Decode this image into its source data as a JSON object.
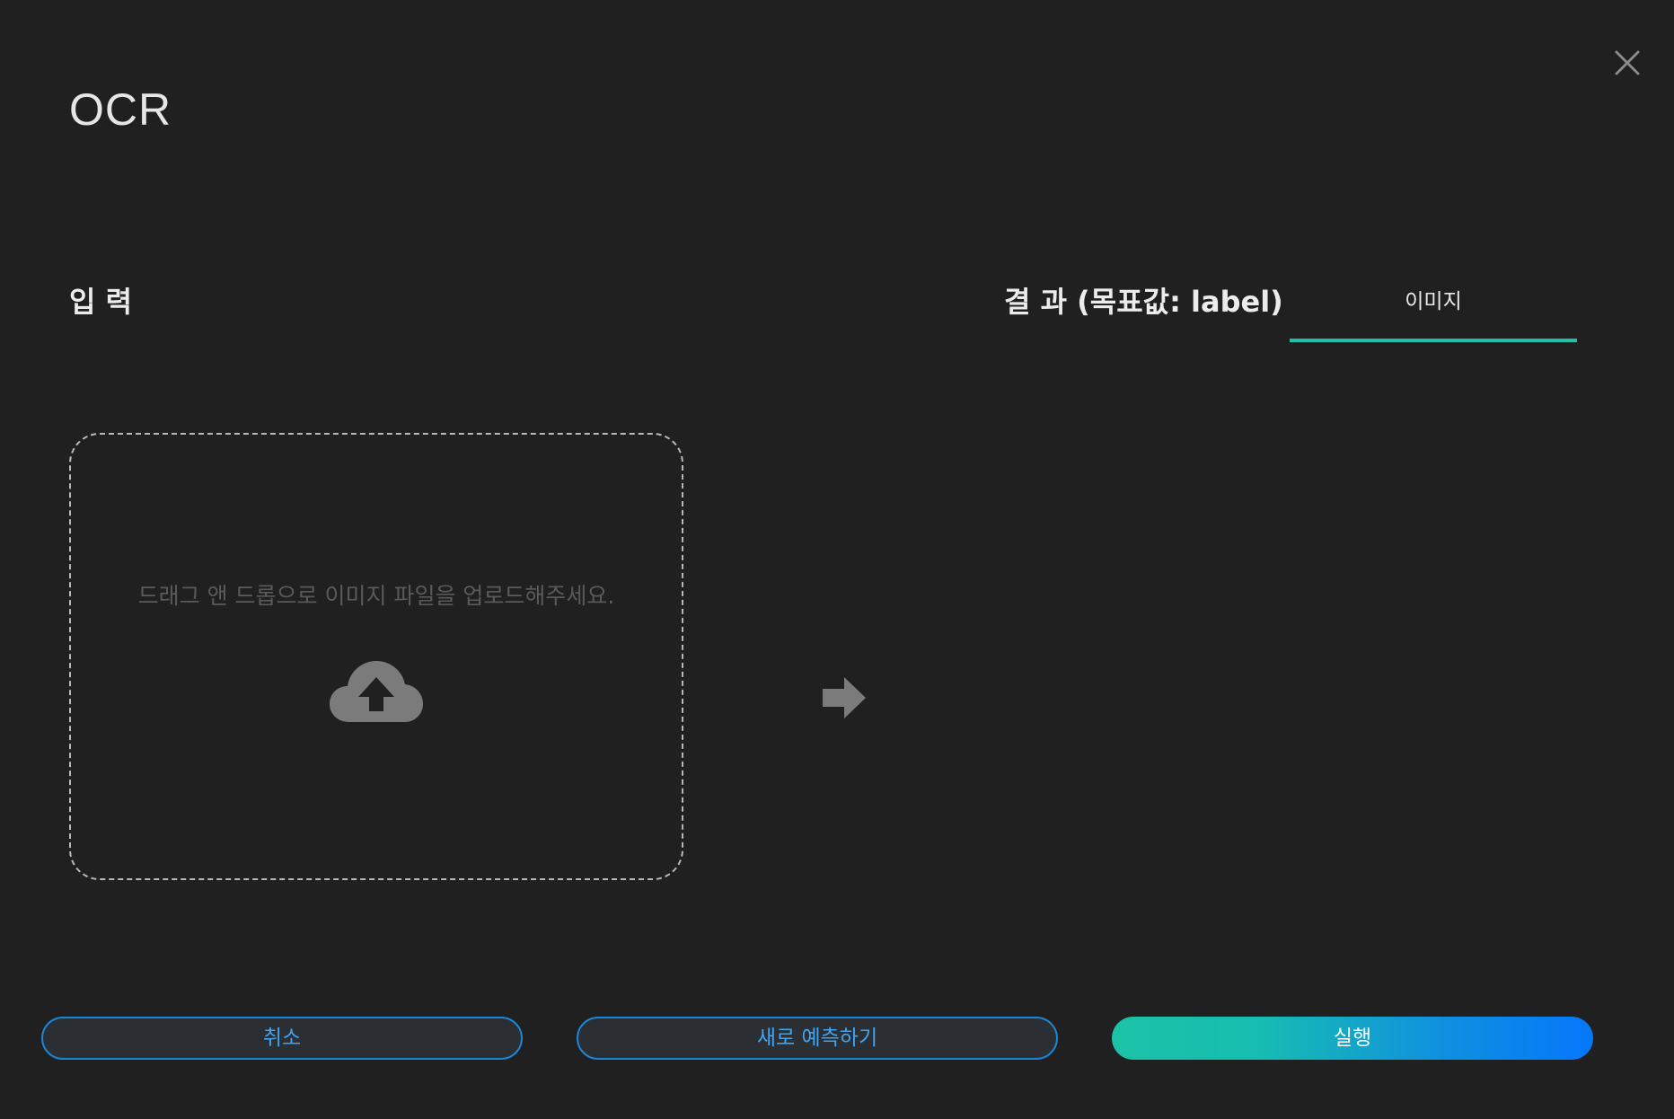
{
  "dialog": {
    "title": "OCR"
  },
  "input": {
    "label": "입 력",
    "dropzone_text": "드래그 앤 드롭으로 이미지 파일을 업로드해주세요."
  },
  "result": {
    "label": "결 과 (목표값: label)",
    "tabs": [
      {
        "label": "이미지",
        "active": true
      }
    ]
  },
  "buttons": {
    "cancel": "취소",
    "new_prediction": "새로 예측하기",
    "run": "실행"
  },
  "colors": {
    "background": "#202020",
    "accent_teal": "#1fc0a6",
    "accent_blue": "#0577fb",
    "outline_blue": "#1a86d6"
  },
  "icons": {
    "close": "close-icon",
    "upload": "cloud-upload-icon",
    "arrow": "arrow-right-icon"
  }
}
